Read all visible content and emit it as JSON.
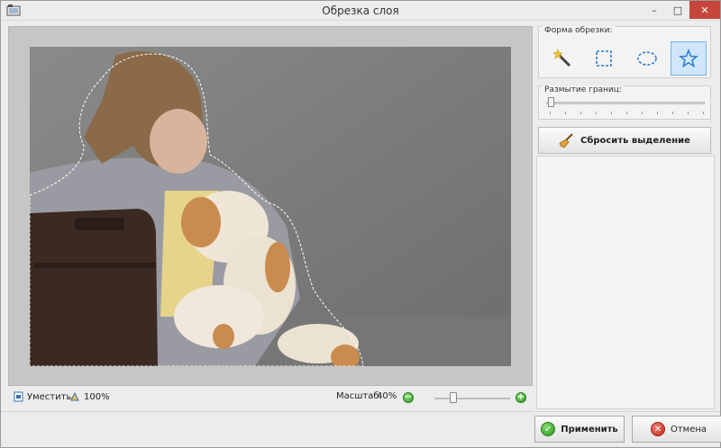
{
  "window": {
    "title": "Обрезка слоя",
    "minimize_glyph": "–",
    "maximize_glyph": "□",
    "close_glyph": "✕"
  },
  "crop_shape": {
    "label": "Форма обрезки:",
    "tools": [
      {
        "name": "magic-wand",
        "icon": "magic-wand-icon",
        "active": false
      },
      {
        "name": "rectangle",
        "icon": "dashed-rectangle-icon",
        "active": false
      },
      {
        "name": "ellipse",
        "icon": "dashed-ellipse-icon",
        "active": false
      },
      {
        "name": "star",
        "icon": "star-icon",
        "active": true
      }
    ]
  },
  "feather": {
    "label": "Размытие границ:",
    "value": 0
  },
  "reset_selection": {
    "label": "Сбросить выделение",
    "icon": "broom-icon"
  },
  "statusbar": {
    "fit_label": "Уместить",
    "actual_size_label": "100%",
    "scale_label": "Масштаб:",
    "scale_value": "40%",
    "zoom_fraction": 0.25,
    "zoom_out_glyph": "−",
    "zoom_in_glyph": "+"
  },
  "actions": {
    "apply_label": "Применить",
    "cancel_label": "Отмена"
  },
  "colors": {
    "accent_selected": "#cfe6fb",
    "apply_green": "#3aa52a",
    "cancel_red": "#d23a2e",
    "close_red": "#c7463c"
  }
}
